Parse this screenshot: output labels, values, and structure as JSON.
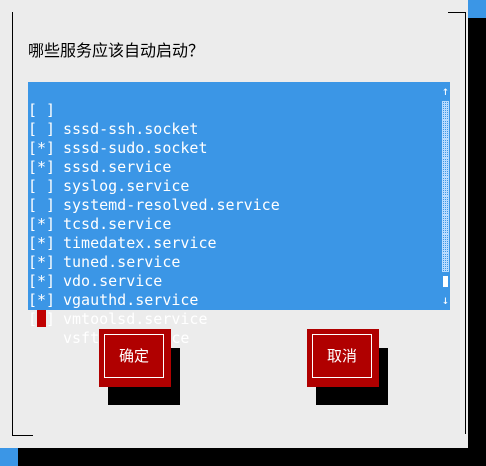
{
  "dialog": {
    "prompt": "哪些服务应该自动启动？"
  },
  "services": [
    {
      "check": "[ ]",
      "name": "sssd-ssh.socket",
      "selected": false
    },
    {
      "check": "[ ]",
      "name": "sssd-sudo.socket",
      "selected": false
    },
    {
      "check": "[*]",
      "name": "sssd.service",
      "selected": true
    },
    {
      "check": "[*]",
      "name": "syslog.service",
      "selected": true
    },
    {
      "check": "[ ]",
      "name": "systemd-resolved.service",
      "selected": false
    },
    {
      "check": "[ ]",
      "name": "tcsd.service",
      "selected": false
    },
    {
      "check": "[*]",
      "name": "timedatex.service",
      "selected": true
    },
    {
      "check": "[*]",
      "name": "tuned.service",
      "selected": true
    },
    {
      "check": "[*]",
      "name": "vdo.service",
      "selected": true
    },
    {
      "check": "[*]",
      "name": "vgauthd.service",
      "selected": true
    },
    {
      "check": "[*]",
      "name": "vmtoolsd.service",
      "selected": true
    },
    {
      "check": "[ ]",
      "name": "vsftpd.service",
      "selected": false,
      "focused": true
    }
  ],
  "scrollbar": {
    "up_arrow": "↑",
    "down_arrow": "↓"
  },
  "buttons": {
    "ok_label": "确定",
    "cancel_label": "取消"
  },
  "colors": {
    "background": "#3b96e6",
    "dialog": "#ececec",
    "button": "#b00000",
    "cursor": "#c00000"
  }
}
